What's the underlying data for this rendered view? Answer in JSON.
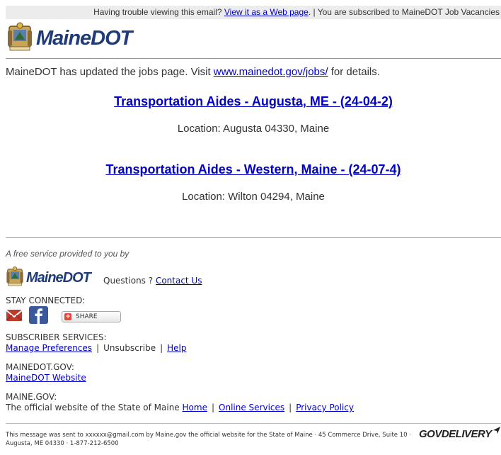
{
  "top_bar": {
    "prefix": "Having trouble viewing this email?",
    "web_link": "View it as a Web page",
    "suffix": ". | You are subscribed to MaineDOT Job Vacancies"
  },
  "header": {
    "logo_text": "MaineDOT"
  },
  "intro": {
    "text_before": "MaineDOT has updated the jobs page. Visit ",
    "link": "www.mainedot.gov/jobs/",
    "text_after": " for details."
  },
  "jobs": [
    {
      "title": "Transportation Aides - Augusta, ME - (24-04-2)",
      "location": "Location: Augusta 04330, Maine"
    },
    {
      "title": "Transportation Aides - Western, Maine - (24-07-4)",
      "location": "Location: Wilton 04294, Maine"
    }
  ],
  "footer": {
    "free_service": "A free service provided to you by",
    "logo_text": "MaineDOT",
    "questions_label": "Questions ?",
    "contact_link": "Contact Us",
    "stay_connected": "STAY CONNECTED:",
    "share_label": "SHARE",
    "subscriber_services": "SUBSCRIBER SERVICES:",
    "manage_preferences": "Manage Preferences",
    "unsubscribe": "Unsubscribe",
    "help": "Help",
    "mainedot_gov_label": "MAINEDOT.GOV:",
    "mainedot_website": "MaineDOT Website",
    "maine_gov_label": "MAINE.GOV:",
    "official_site_text": "The official website of the State of Maine",
    "home": "Home",
    "online_services": "Online Services",
    "privacy_policy": "Privacy Policy",
    "fineprint": "This message was sent to xxxxxx@gmail.com by Maine.gov the official website for the State of Maine · 45 Commerce Drive, Suite 10 · Augusta, ME 04330 · 1-877-212-6500",
    "govdelivery": "GOVDELIVERY"
  },
  "icon_names": [
    "state-seal-icon",
    "email-share-icon",
    "facebook-icon",
    "addthis-plus-icon",
    "govdelivery-arrow-icon"
  ],
  "colors": {
    "link": "#0000cc",
    "brand": "#1f3b7a",
    "facebook": "#3b5998",
    "email_icon": "#c0392b"
  }
}
